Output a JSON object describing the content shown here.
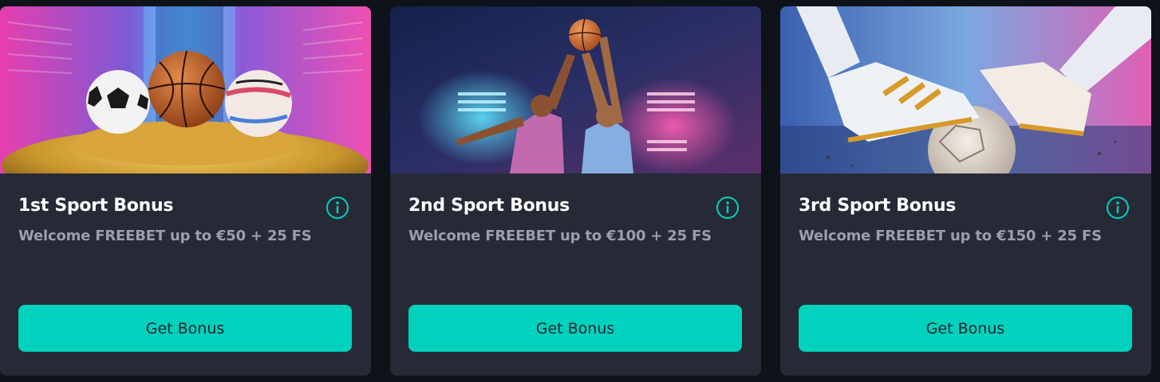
{
  "colors": {
    "page_background": "#0e1219",
    "card_background": "#262a36",
    "accent": "#00d2bd",
    "title_text": "#ffffff",
    "subtitle_text": "#9b9fab",
    "button_text": "#1b2430"
  },
  "cards": [
    {
      "title": "1st Sport Bonus",
      "subtitle": "Welcome FREEBET up to €50 + 25 FS",
      "button_label": "Get Bonus",
      "info_icon": "info-circle-icon",
      "image": "sports-balls-on-gold-coins"
    },
    {
      "title": "2nd Sport Bonus",
      "subtitle": "Welcome FREEBET up to €100 + 25 FS",
      "button_label": "Get Bonus",
      "info_icon": "info-circle-icon",
      "image": "basketball-players-jumping"
    },
    {
      "title": "3rd Sport Bonus",
      "subtitle": "Welcome FREEBET up to €150 + 25 FS",
      "button_label": "Get Bonus",
      "info_icon": "info-circle-icon",
      "image": "football-boots-on-ball"
    }
  ]
}
